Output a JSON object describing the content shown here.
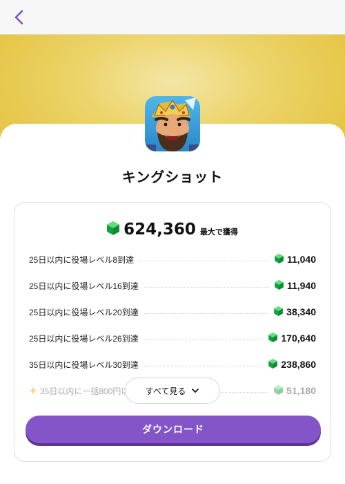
{
  "colors": {
    "accent": "#8455c8",
    "banner": "#e5c341",
    "gem": "#19b049"
  },
  "header": {
    "back_icon": "chevron-left-icon"
  },
  "app": {
    "name": "キングショット",
    "icon": "king-character-app-icon"
  },
  "rewards": {
    "total_value": "624,360",
    "total_suffix": "最大で獲得",
    "currency_icon": "green-gem-icon",
    "items": [
      {
        "label": "25日以内に役場レベル8到達",
        "value": "11,040"
      },
      {
        "label": "25日以内に役場レベル16到達",
        "value": "11,940"
      },
      {
        "label": "25日以内に役場レベル20到達",
        "value": "38,340"
      },
      {
        "label": "25日以内に役場レベル26到達",
        "value": "170,640"
      },
      {
        "label": "35日以内に役場レベル30到達",
        "value": "238,860"
      },
      {
        "label": "35日以内に一括800円以上購入",
        "value": "51,180"
      }
    ]
  },
  "see_all": {
    "label": "すべて見る",
    "icon": "chevron-down-icon"
  },
  "download": {
    "label": "ダウンロード"
  }
}
